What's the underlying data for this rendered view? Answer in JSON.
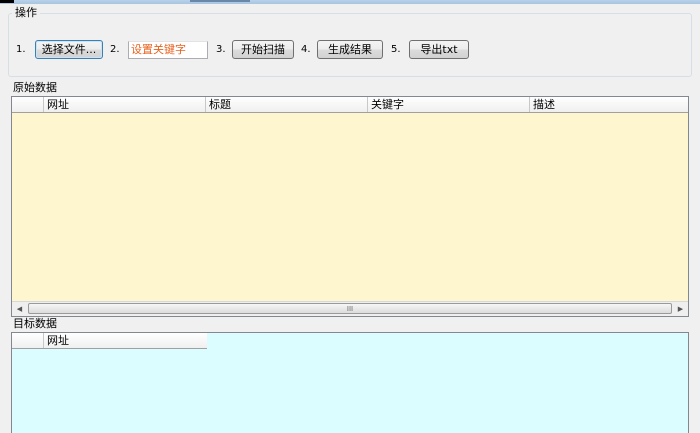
{
  "window": {
    "title_strip": ""
  },
  "operations": {
    "group_title": "操作",
    "steps": [
      {
        "num": "1.",
        "label": "选择文件..."
      },
      {
        "num": "2.",
        "placeholder": "设置关键字"
      },
      {
        "num": "3.",
        "label": "开始扫描"
      },
      {
        "num": "4.",
        "label": "生成结果"
      },
      {
        "num": "5.",
        "label": "导出txt"
      }
    ]
  },
  "source_data": {
    "section_label": "原始数据",
    "columns": [
      "网址",
      "标题",
      "关键字",
      "描述"
    ],
    "rows": [],
    "background": "#fdf6cf",
    "scroll_grip": "III"
  },
  "target_data": {
    "section_label": "目标数据",
    "columns": [
      "网址"
    ],
    "rows": [],
    "background": "#dcfdff"
  },
  "icons": {
    "scroll_left": "left-arrow-icon",
    "scroll_right": "right-arrow-icon"
  }
}
